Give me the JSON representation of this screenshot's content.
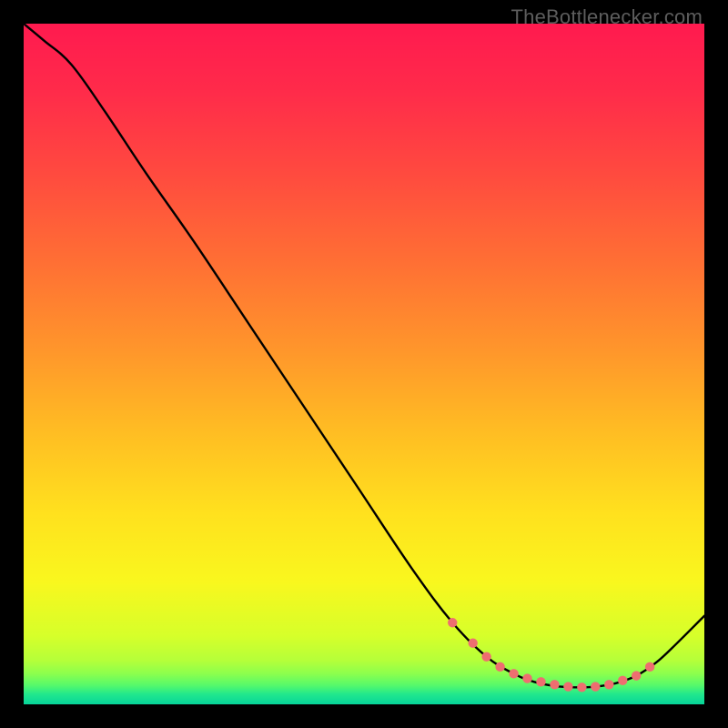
{
  "watermark": "TheBottlenecker.com",
  "chart_data": {
    "type": "line",
    "title": "",
    "xlabel": "",
    "ylabel": "",
    "xlim": [
      0,
      100
    ],
    "ylim": [
      0,
      100
    ],
    "grid": false,
    "series": [
      {
        "name": "curve",
        "color": "#000000",
        "x": [
          0,
          3,
          7,
          12,
          18,
          25,
          33,
          41,
          49,
          57,
          63,
          68,
          72,
          75,
          78,
          81,
          84,
          87,
          90,
          93,
          96,
          100
        ],
        "y": [
          100,
          97.5,
          94,
          87,
          78,
          68,
          56,
          44,
          32,
          20,
          12,
          7,
          4.5,
          3.3,
          2.7,
          2.5,
          2.6,
          3.1,
          4.2,
          6.2,
          9,
          13
        ]
      }
    ],
    "points": {
      "name": "markers",
      "color": "#ee6e70",
      "x": [
        63,
        66,
        68,
        70,
        72,
        74,
        76,
        78,
        80,
        82,
        84,
        86,
        88,
        90,
        92
      ],
      "y": [
        12,
        9,
        7,
        5.5,
        4.5,
        3.8,
        3.3,
        2.9,
        2.6,
        2.5,
        2.6,
        2.9,
        3.5,
        4.2,
        5.5
      ]
    },
    "gradient_stops": [
      {
        "offset": 0.0,
        "color": "#ff1a4f"
      },
      {
        "offset": 0.1,
        "color": "#ff2b4a"
      },
      {
        "offset": 0.22,
        "color": "#ff4a3f"
      },
      {
        "offset": 0.35,
        "color": "#ff6f34"
      },
      {
        "offset": 0.48,
        "color": "#ff962b"
      },
      {
        "offset": 0.6,
        "color": "#ffbd23"
      },
      {
        "offset": 0.72,
        "color": "#ffe11e"
      },
      {
        "offset": 0.82,
        "color": "#f9f71e"
      },
      {
        "offset": 0.9,
        "color": "#d6ff2a"
      },
      {
        "offset": 0.935,
        "color": "#b6ff39"
      },
      {
        "offset": 0.955,
        "color": "#8cff4d"
      },
      {
        "offset": 0.972,
        "color": "#56f96b"
      },
      {
        "offset": 0.985,
        "color": "#22e88c"
      },
      {
        "offset": 1.0,
        "color": "#06d49a"
      }
    ]
  }
}
